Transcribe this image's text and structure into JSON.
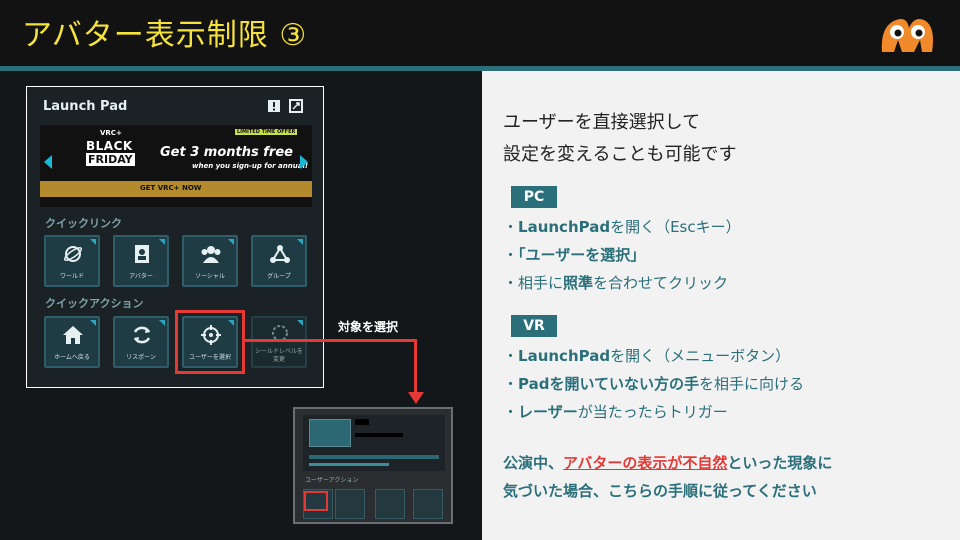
{
  "header": {
    "title": "アバター表示制限 ③"
  },
  "launchpad": {
    "title": "Launch Pad",
    "banner": {
      "vrc_plus": "VRC+",
      "black": "BLACK",
      "friday": "FRIDAY",
      "limited": "LIMITED TIME OFFER",
      "headline": "Get 3 months free",
      "subline": "when you sign-up for annual!",
      "cta": "GET VRC+ NOW"
    },
    "quick_links_label": "クイックリンク",
    "quick_links": [
      {
        "label": "ワールド",
        "icon": "world-icon"
      },
      {
        "label": "アバター",
        "icon": "avatar-icon"
      },
      {
        "label": "ソーシャル",
        "icon": "social-icon"
      },
      {
        "label": "グループ",
        "icon": "group-icon"
      }
    ],
    "quick_actions_label": "クイックアクション",
    "quick_actions": [
      {
        "label": "ホームへ戻る",
        "icon": "home-icon"
      },
      {
        "label": "リスポーン",
        "icon": "respawn-icon"
      },
      {
        "label": "ユーザーを選択",
        "icon": "crosshair-icon"
      },
      {
        "label": "シールドレベルを変更",
        "icon": "shield-icon"
      }
    ]
  },
  "callout": "対象を選択",
  "mini": {
    "label": "ユーザーアクション"
  },
  "right": {
    "intro_line1": "ユーザーを直接選択して",
    "intro_line2": "設定を変えることも可能です",
    "pc_badge": "PC",
    "pc_item1_bold": "LaunchPad",
    "pc_item1_rest": "を開く（Escキー）",
    "pc_item2": "「ユーザーを選択」",
    "pc_item3_a": "相手に",
    "pc_item3_bold": "照準",
    "pc_item3_b": "を合わせてクリック",
    "vr_badge": "VR",
    "vr_item1_bold": "LaunchPad",
    "vr_item1_rest": "を開く（メニューボタン）",
    "vr_item2_bold": "Padを開いていない方の手",
    "vr_item2_rest": "を相手に向ける",
    "vr_item3_bold": "レーザー",
    "vr_item3_rest": "が当たったらトリガー",
    "bullet": "・",
    "note_pre": "公演中、",
    "note_red": "アバターの表示が不自然",
    "note_post": "といった現象に",
    "note_line2": "気づいた場合、こちらの手順に従ってください"
  },
  "colors": {
    "accent": "#2a6f7a",
    "title": "#f5e23a",
    "highlight": "#e53935"
  }
}
